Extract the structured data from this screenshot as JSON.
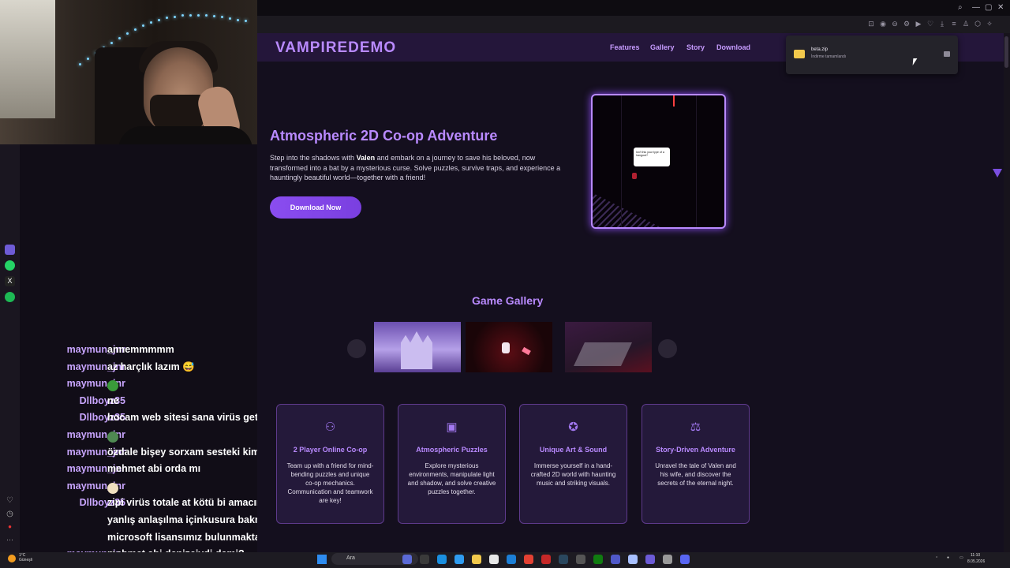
{
  "browser": {
    "window_controls": [
      "—",
      "▢",
      "✕"
    ]
  },
  "site": {
    "logo": "VAMPIREDEMO",
    "nav": [
      "Features",
      "Gallery",
      "Story",
      "Download"
    ],
    "hero": {
      "title": "Atmospheric 2D Co-op Adventure",
      "text_before": "Step into the shadows with ",
      "text_bold": "Valen",
      "text_after": " and embark on a journey to save his beloved, now transformed into a bat by a mysterious curse. Solve puzzles, survive traps, and experience a hauntingly beautiful world—together with a friend!",
      "button": "Download Now",
      "speech": "Isn't this your type of a hangout?"
    },
    "gallery": {
      "title": "Game Gallery"
    },
    "features": [
      {
        "icon": "users-icon",
        "title": "2 Player Online Co-op",
        "desc": "Team up with a friend for mind-bending puzzles and unique co-op mechanics. Communication and teamwork are key!"
      },
      {
        "icon": "puzzle-icon",
        "title": "Atmospheric Puzzles",
        "desc": "Explore mysterious environments, manipulate light and shadow, and solve creative puzzles together."
      },
      {
        "icon": "palette-icon",
        "title": "Unique Art & Sound",
        "desc": "Immerse yourself in a hand-crafted 2D world with haunting music and striking visuals."
      },
      {
        "icon": "book-icon",
        "title": "Story-Driven Adventure",
        "desc": "Unravel the tale of Valen and his wife, and discover the secrets of the eternal night."
      }
    ]
  },
  "download": {
    "file_name": "beta.zip",
    "status": "İndirme tamamlandı"
  },
  "chat": [
    {
      "user": "maymun_jnr",
      "msg": "annemmmmm"
    },
    {
      "user": "maymun_jnr",
      "msg": "az harçlık lazım 😅"
    },
    {
      "user": "maymun_jnr",
      "msg": "",
      "emote": "#3a9b3a"
    },
    {
      "user": "Dllboyz35",
      "msg": "ne"
    },
    {
      "user": "Dllboyz35",
      "msg": "hocam web sitesi sana virüs getirmez"
    },
    {
      "user": "maymun_jnr",
      "msg": "",
      "emote": "#4f8a52"
    },
    {
      "user": "maymun_jnr",
      "msg": "özdale bişey sorxam sesteki kim"
    },
    {
      "user": "maymun_jnr",
      "msg": "mehmet abi orda mı"
    },
    {
      "user": "maymun_jnr",
      "msg": "",
      "emote": "#f0e0c0"
    },
    {
      "user": "Dllboyz35",
      "msg": "zipi virüs totale at kötü bi amacımız yok"
    },
    {
      "user": "",
      "msg": "yanlış anlaşılma içinkusura bakma"
    },
    {
      "user": "",
      "msg": "microsoft lisansımız bulunmakta"
    },
    {
      "user": "maymun_jnr",
      "msg": "mehmet abi denizciydi demi?"
    }
  ],
  "taskbar": {
    "weather_temp": "1°C",
    "weather_desc": "Güneşli",
    "search_placeholder": "Ara",
    "time": "11:10",
    "date": "8.05.2026"
  },
  "colors": {
    "accent": "#b98aff",
    "button": "#8a4df0",
    "background": "#140f1e"
  }
}
